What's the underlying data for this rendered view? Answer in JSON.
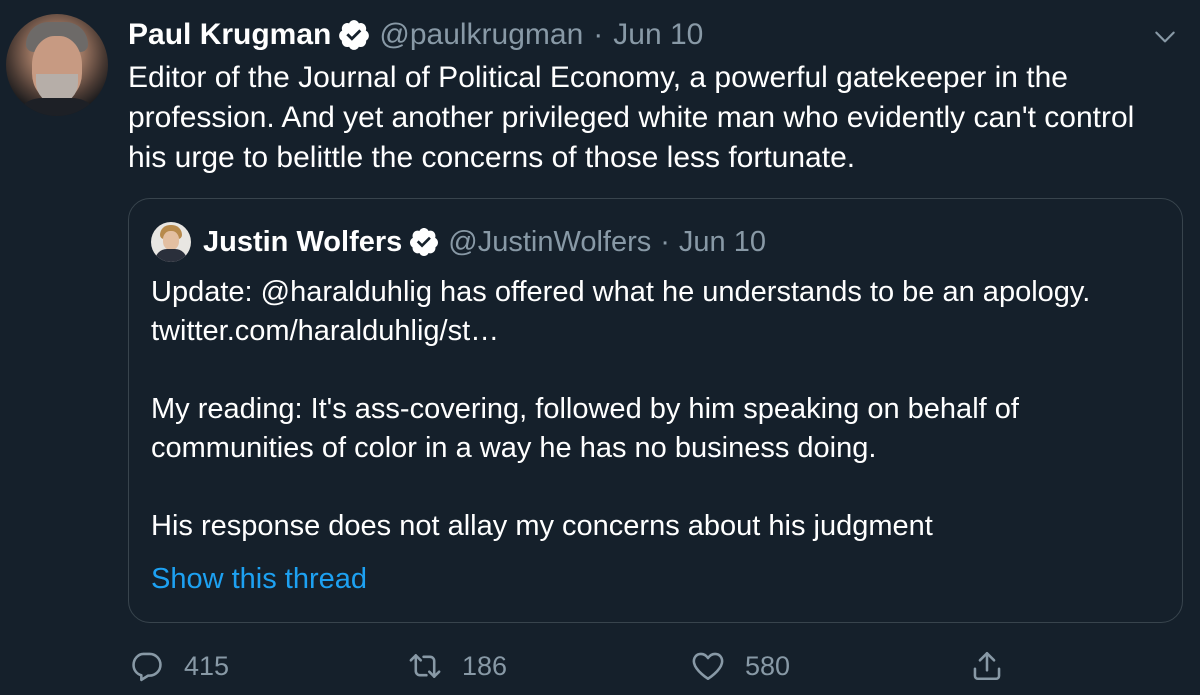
{
  "tweet": {
    "author_name": "Paul Krugman",
    "author_handle": "@paulkrugman",
    "separator": "·",
    "date": "Jun 10",
    "text": "Editor of the Journal of Political Economy, a powerful gatekeeper in the profession. And yet another privileged white man who evidently can't control his urge to belittle the concerns of those less fortunate.",
    "verified": true,
    "avatar_icon": "avatar-photo",
    "menu_icon": "chevron-down-icon"
  },
  "quoted_tweet": {
    "author_name": "Justin Wolfers",
    "author_handle": "@JustinWolfers",
    "separator": "·",
    "date": "Jun 10",
    "verified": true,
    "paragraphs": [
      "Update: @haralduhlig has offered what he understands to be an apology. twitter.com/haralduhlig/st…",
      "My reading: It's ass-covering, followed by him speaking on behalf of communities of color in a way he has no business doing.",
      "His response does not allay my concerns about his judgment"
    ],
    "show_thread_label": "Show this thread"
  },
  "actions": {
    "reply_count": "415",
    "retweet_count": "186",
    "like_count": "580",
    "reply_icon": "reply-icon",
    "retweet_icon": "retweet-icon",
    "like_icon": "heart-icon",
    "share_icon": "share-icon"
  },
  "colors": {
    "background": "#15202b",
    "text": "#ffffff",
    "muted": "#8899a6",
    "link": "#1da1f2",
    "border": "#38444d"
  }
}
